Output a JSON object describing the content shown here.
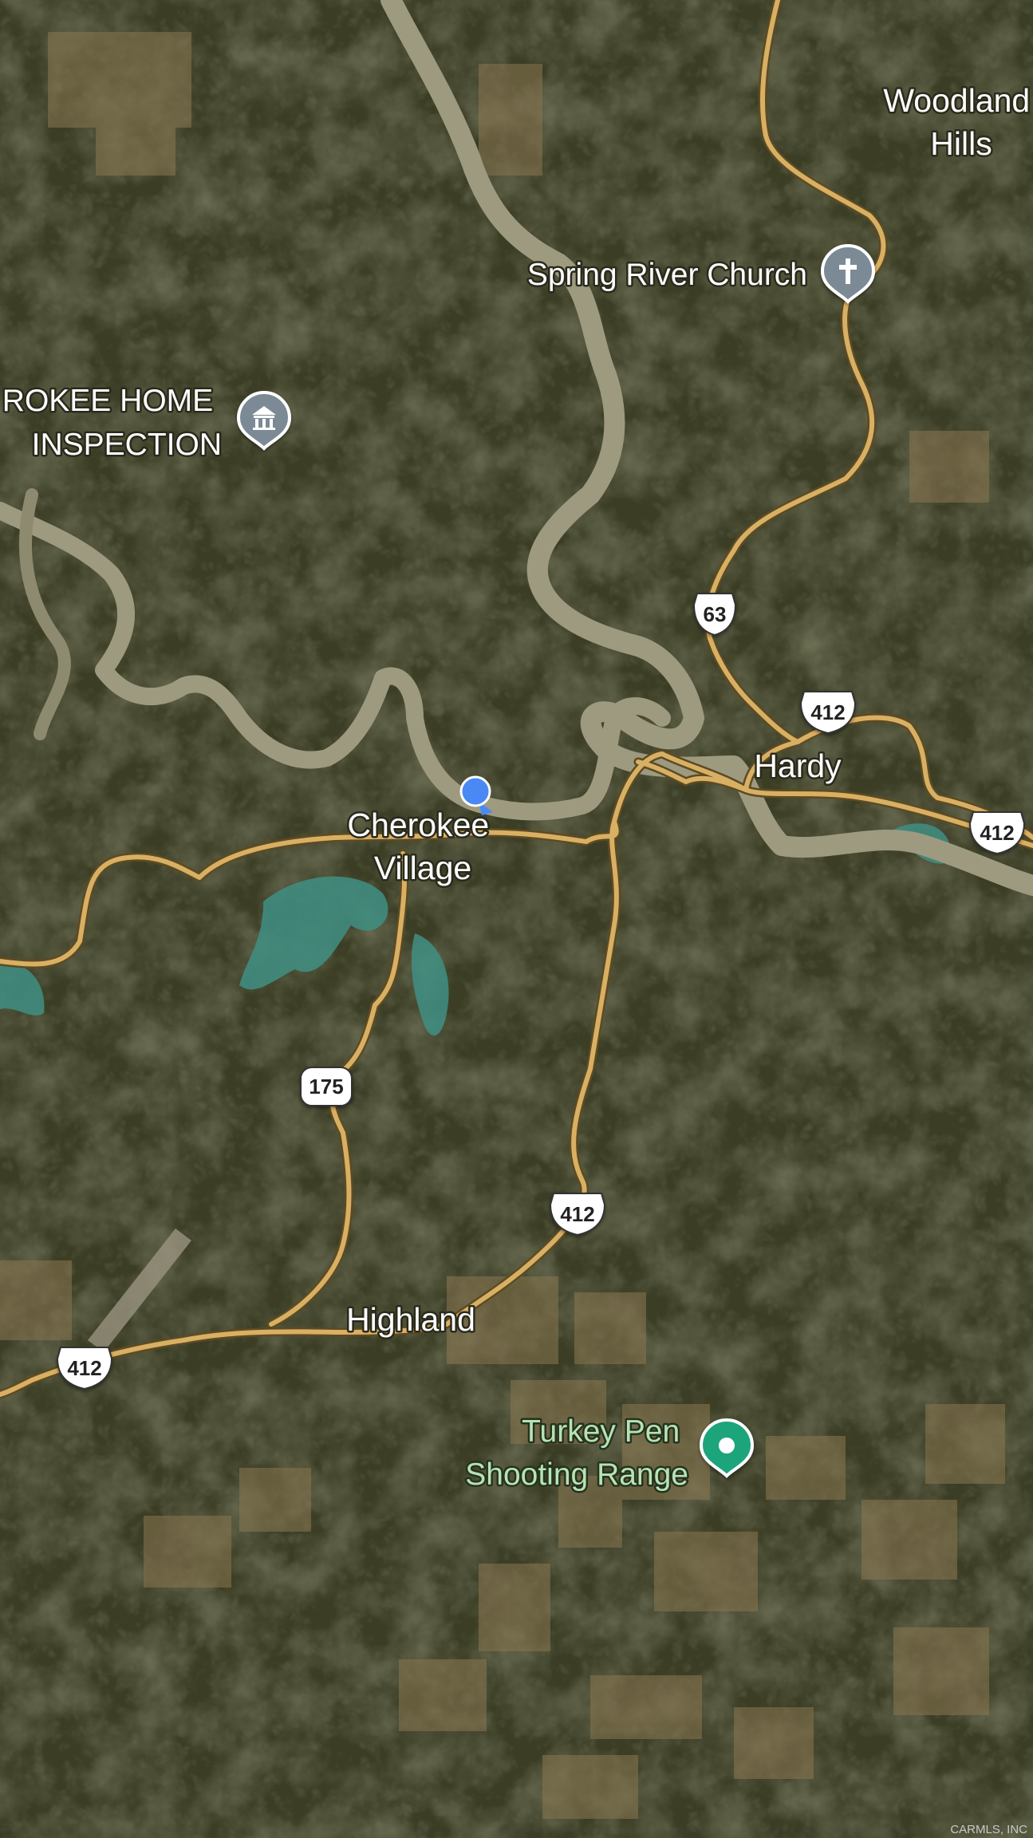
{
  "map": {
    "type": "satellite",
    "colors": {
      "forest": "#3a3d24",
      "road": "#d8b064",
      "road_casing": "#5e4a22",
      "river": "#a19d82",
      "lake": "#3f8f84",
      "farmland": "#8a7752",
      "location_dot": "#4a89f3",
      "poi_gray": "#7c8a96",
      "poi_green": "#1fa57a"
    },
    "places": {
      "woodland_hills": [
        "Woodland",
        "Hills"
      ],
      "hardy": "Hardy",
      "cherokee_village": [
        "Cherokee",
        "Village"
      ],
      "highland": "Highland"
    },
    "pois": {
      "spring_river_church": {
        "name": "Spring River Church",
        "icon": "cross-icon"
      },
      "home_inspection": {
        "name": [
          "ROKEE HOME",
          "INSPECTION"
        ],
        "icon": "building-icon"
      },
      "turkey_pen": {
        "name": [
          "Turkey Pen",
          "Shooting Range"
        ],
        "icon": "pin-dot-icon"
      }
    },
    "shields": {
      "us63": "63",
      "us412_hardy": "412",
      "us412_east": "412",
      "ar175": "175",
      "us412_south": "412",
      "us412_west": "412"
    },
    "credit": "CARMLS, INC"
  }
}
